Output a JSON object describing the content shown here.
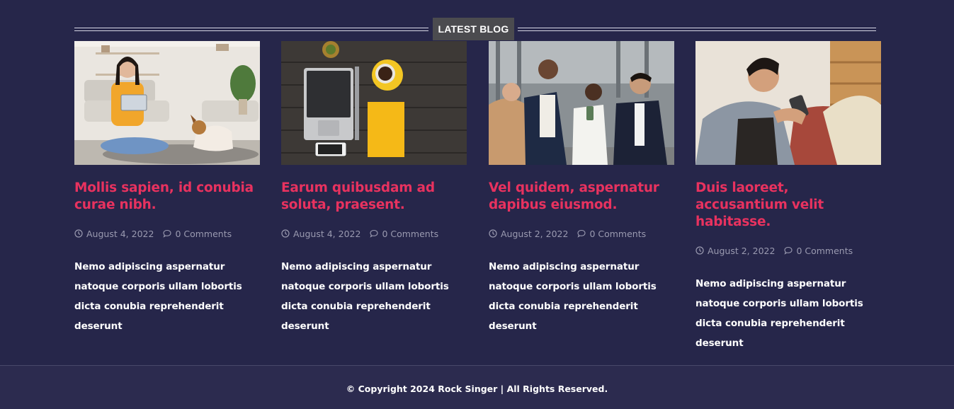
{
  "section": {
    "heading": "LATEST BLOG"
  },
  "posts": [
    {
      "title": "Mollis sapien, id conubia curae nibh.",
      "date": "August 4, 2022",
      "comments": "0 Comments",
      "excerpt": "Nemo adipiscing aspernatur natoque corporis ullam lobortis dicta conubia reprehenderit deserunt",
      "image": "woman-with-tablet-and-dog"
    },
    {
      "title": "Earum quibusdam ad soluta, praesent.",
      "date": "August 4, 2022",
      "comments": "0 Comments",
      "excerpt": "Nemo adipiscing aspernatur natoque corporis ullam lobortis dicta conubia reprehenderit deserunt",
      "image": "laptop-coffee-desk"
    },
    {
      "title": "Vel quidem, aspernatur dapibus eiusmod.",
      "date": "August 2, 2022",
      "comments": "0 Comments",
      "excerpt": "Nemo adipiscing aspernatur natoque corporis ullam lobortis dicta conubia reprehenderit deserunt",
      "image": "business-people-group"
    },
    {
      "title": "Duis laoreet, accusantium velit habitasse.",
      "date": "August 2, 2022",
      "comments": "0 Comments",
      "excerpt": "Nemo adipiscing aspernatur natoque corporis ullam lobortis dicta conubia reprehenderit deserunt",
      "image": "man-with-phone-on-sofa"
    }
  ],
  "footer": {
    "copyright": "© Copyright 2024 Rock Singer | All Rights Reserved."
  },
  "colors": {
    "background": "#26264a",
    "title_accent": "#e8325f",
    "meta_text": "#9a9ab0",
    "heading_tag_bg": "#4b4b4f"
  },
  "icons": {
    "date": "clock-icon",
    "comments": "comment-bubble-icon"
  }
}
